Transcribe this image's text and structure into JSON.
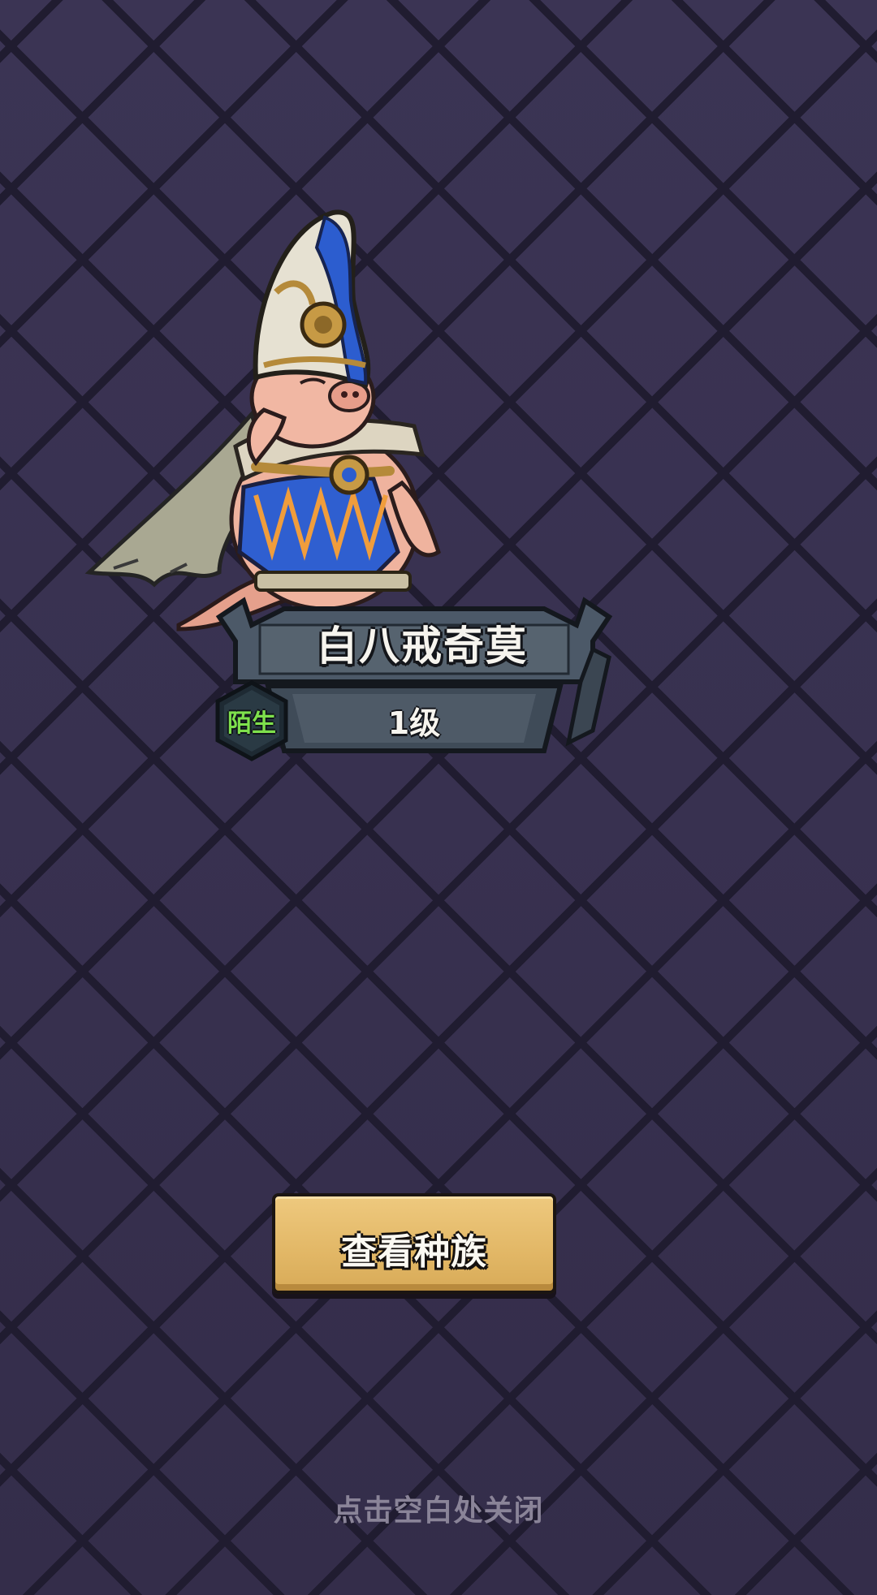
{
  "hero": {
    "name": "白八戒奇莫",
    "level": "1级",
    "relation": "陌生"
  },
  "actions": {
    "view_race_label": "查看种族"
  },
  "hint": {
    "close_text": "点击空白处关闭"
  },
  "colors": {
    "background": "#3a3352",
    "button_gold": "#e2b766",
    "relation_green": "#7ee04c",
    "plate_steel": "#4a5664"
  }
}
